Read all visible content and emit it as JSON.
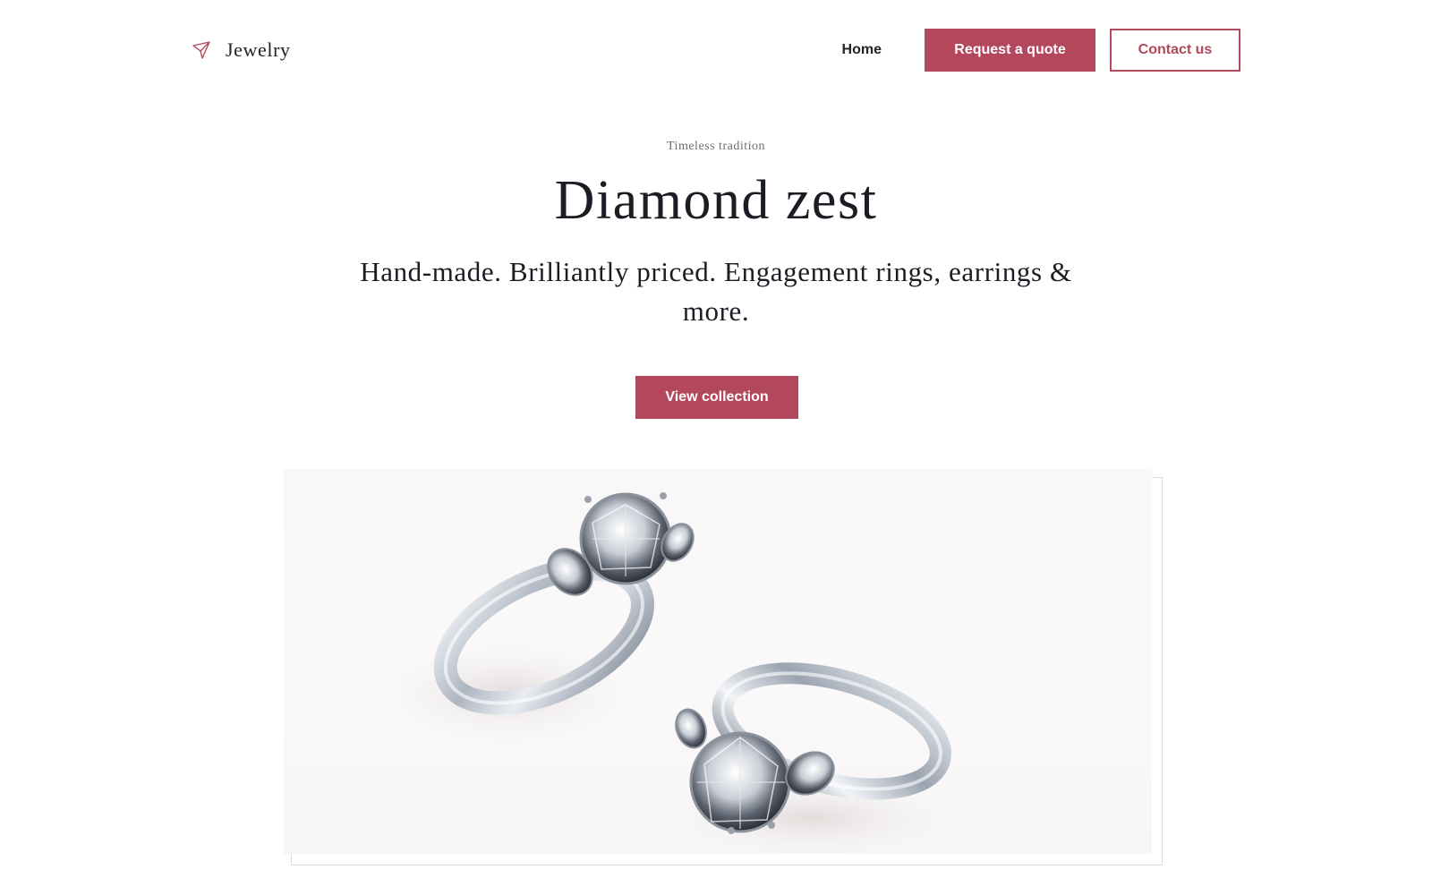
{
  "brand": {
    "name": "Jewelry",
    "icon": "paper-plane-icon"
  },
  "nav": {
    "home_label": "Home",
    "quote_label": "Request a quote",
    "contact_label": "Contact us"
  },
  "hero": {
    "eyebrow": "Timeless tradition",
    "title": "Diamond zest",
    "subtitle": "Hand-made. Brilliantly priced. Engagement rings, earrings & more.",
    "cta_label": "View collection"
  },
  "colors": {
    "accent": "#b3475b",
    "text": "#1c1d24",
    "muted": "#6e6e72"
  },
  "product_image": {
    "subject": "two diamond engagement rings"
  }
}
